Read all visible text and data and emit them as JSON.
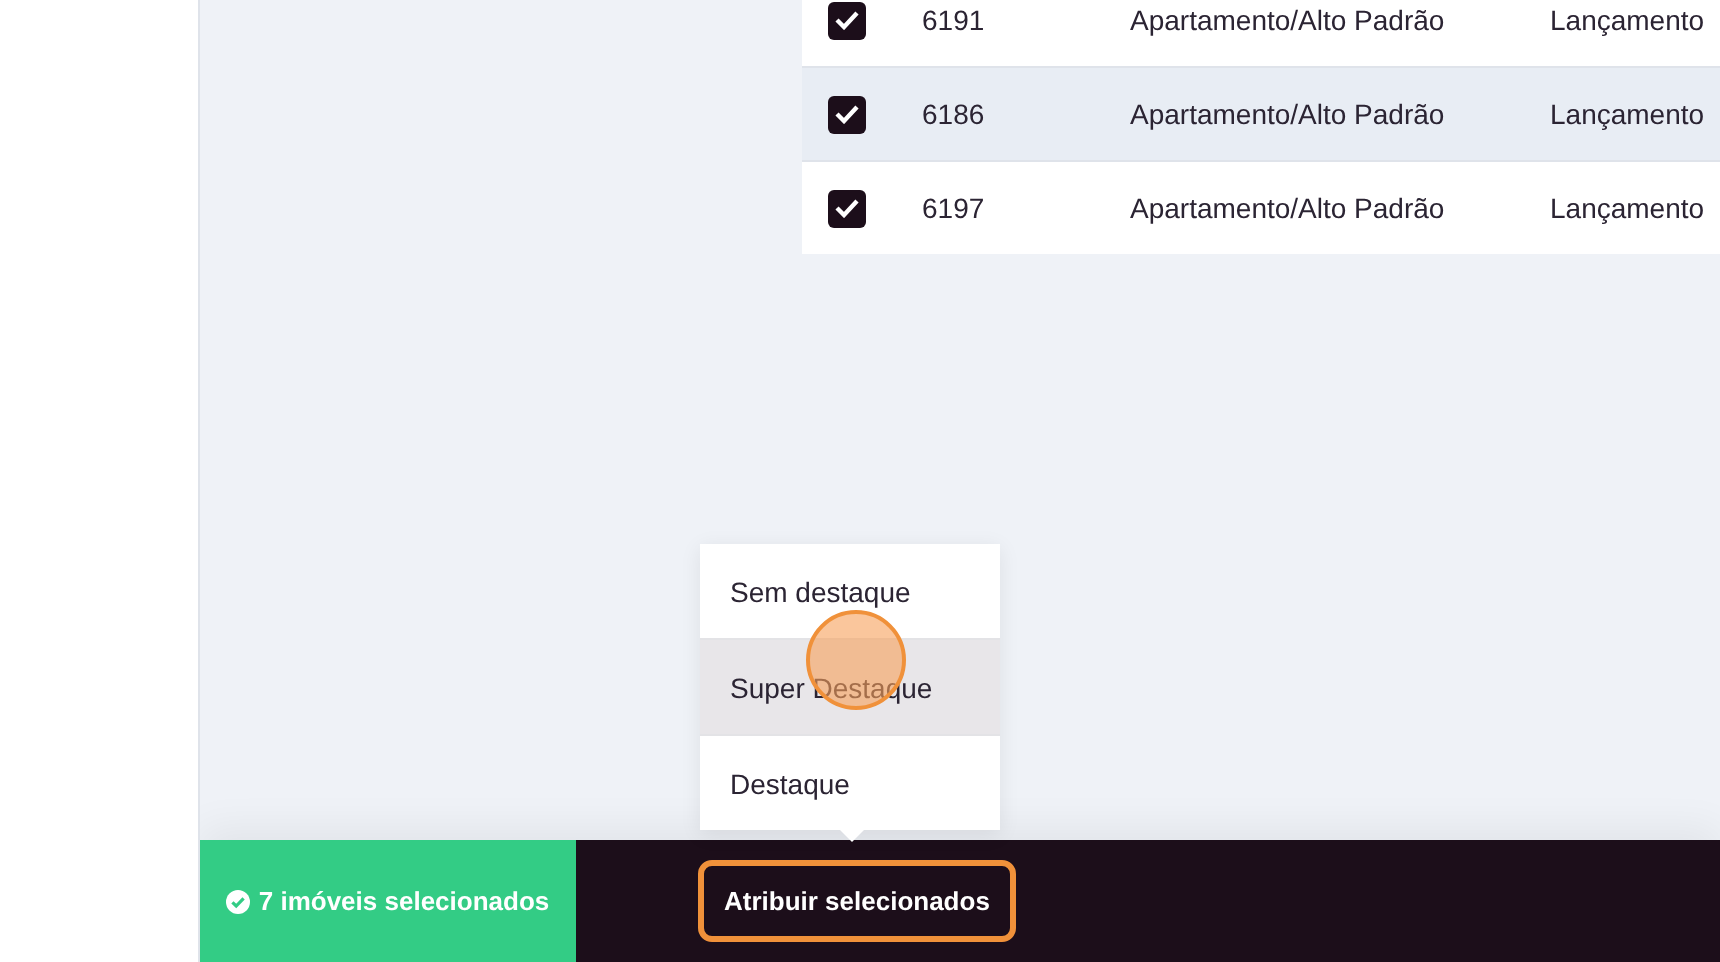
{
  "table": {
    "rows": [
      {
        "checked": true,
        "selected": false,
        "code": "6191",
        "type": "Apartamento/Alto Padrão",
        "status": "Lançamento"
      },
      {
        "checked": true,
        "selected": true,
        "code": "6186",
        "type": "Apartamento/Alto Padrão",
        "status": "Lançamento"
      },
      {
        "checked": true,
        "selected": false,
        "code": "6197",
        "type": "Apartamento/Alto Padrão",
        "status": "Lançamento"
      }
    ]
  },
  "menu": {
    "items": [
      {
        "label": "Sem destaque",
        "selected": false
      },
      {
        "label": "Super Destaque",
        "selected": true
      },
      {
        "label": "Destaque",
        "selected": false
      }
    ]
  },
  "bottom_bar": {
    "selection_count": "7 imóveis selecionados",
    "assign_button": "Atribuir selecionados"
  }
}
